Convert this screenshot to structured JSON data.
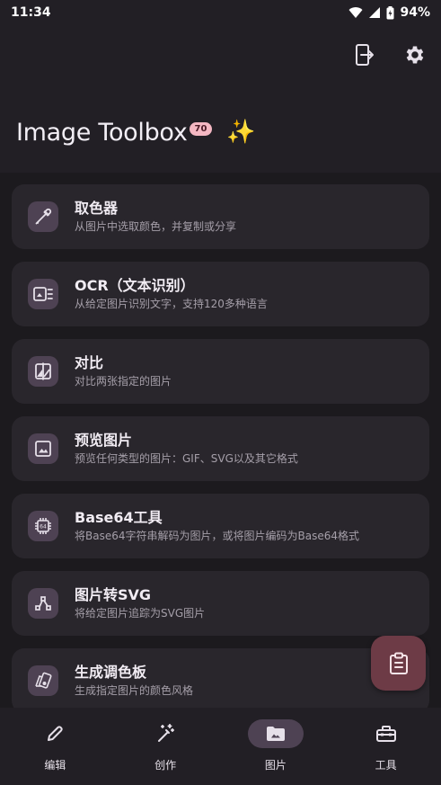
{
  "status_bar": {
    "time": "11:34",
    "battery": "94%"
  },
  "header": {
    "title": "Image Toolbox",
    "version_badge": "70",
    "sparkle": "✨"
  },
  "tools": [
    {
      "title": "取色器",
      "subtitle": "从图片中选取颜色，并复制或分享",
      "icon": "eyedropper-icon"
    },
    {
      "title": "OCR（文本识别）",
      "subtitle": "从给定图片识别文字，支持120多种语言",
      "icon": "ocr-icon"
    },
    {
      "title": "对比",
      "subtitle": "对比两张指定的图片",
      "icon": "compare-icon"
    },
    {
      "title": "预览图片",
      "subtitle": "预览任何类型的图片：GIF、SVG以及其它格式",
      "icon": "image-preview-icon"
    },
    {
      "title": "Base64工具",
      "subtitle": "将Base64字符串解码为图片，或将图片编码为Base64格式",
      "icon": "base64-chip-icon"
    },
    {
      "title": "图片转SVG",
      "subtitle": "将给定图片追踪为SVG图片",
      "icon": "svg-trace-icon"
    },
    {
      "title": "生成调色板",
      "subtitle": "生成指定图片的颜色风格",
      "icon": "palette-icon"
    }
  ],
  "bottom_nav": [
    {
      "label": "编辑",
      "icon": "pencil-icon",
      "active": false
    },
    {
      "label": "创作",
      "icon": "magic-wand-icon",
      "active": false
    },
    {
      "label": "图片",
      "icon": "image-folder-icon",
      "active": true
    },
    {
      "label": "工具",
      "icon": "toolbox-icon",
      "active": false
    }
  ],
  "colors": {
    "background": "#1c1a1e",
    "card": "#29262c",
    "icon_tile": "#4e4253",
    "fab": "#6d3b46",
    "badge": "#f4b7c2"
  }
}
